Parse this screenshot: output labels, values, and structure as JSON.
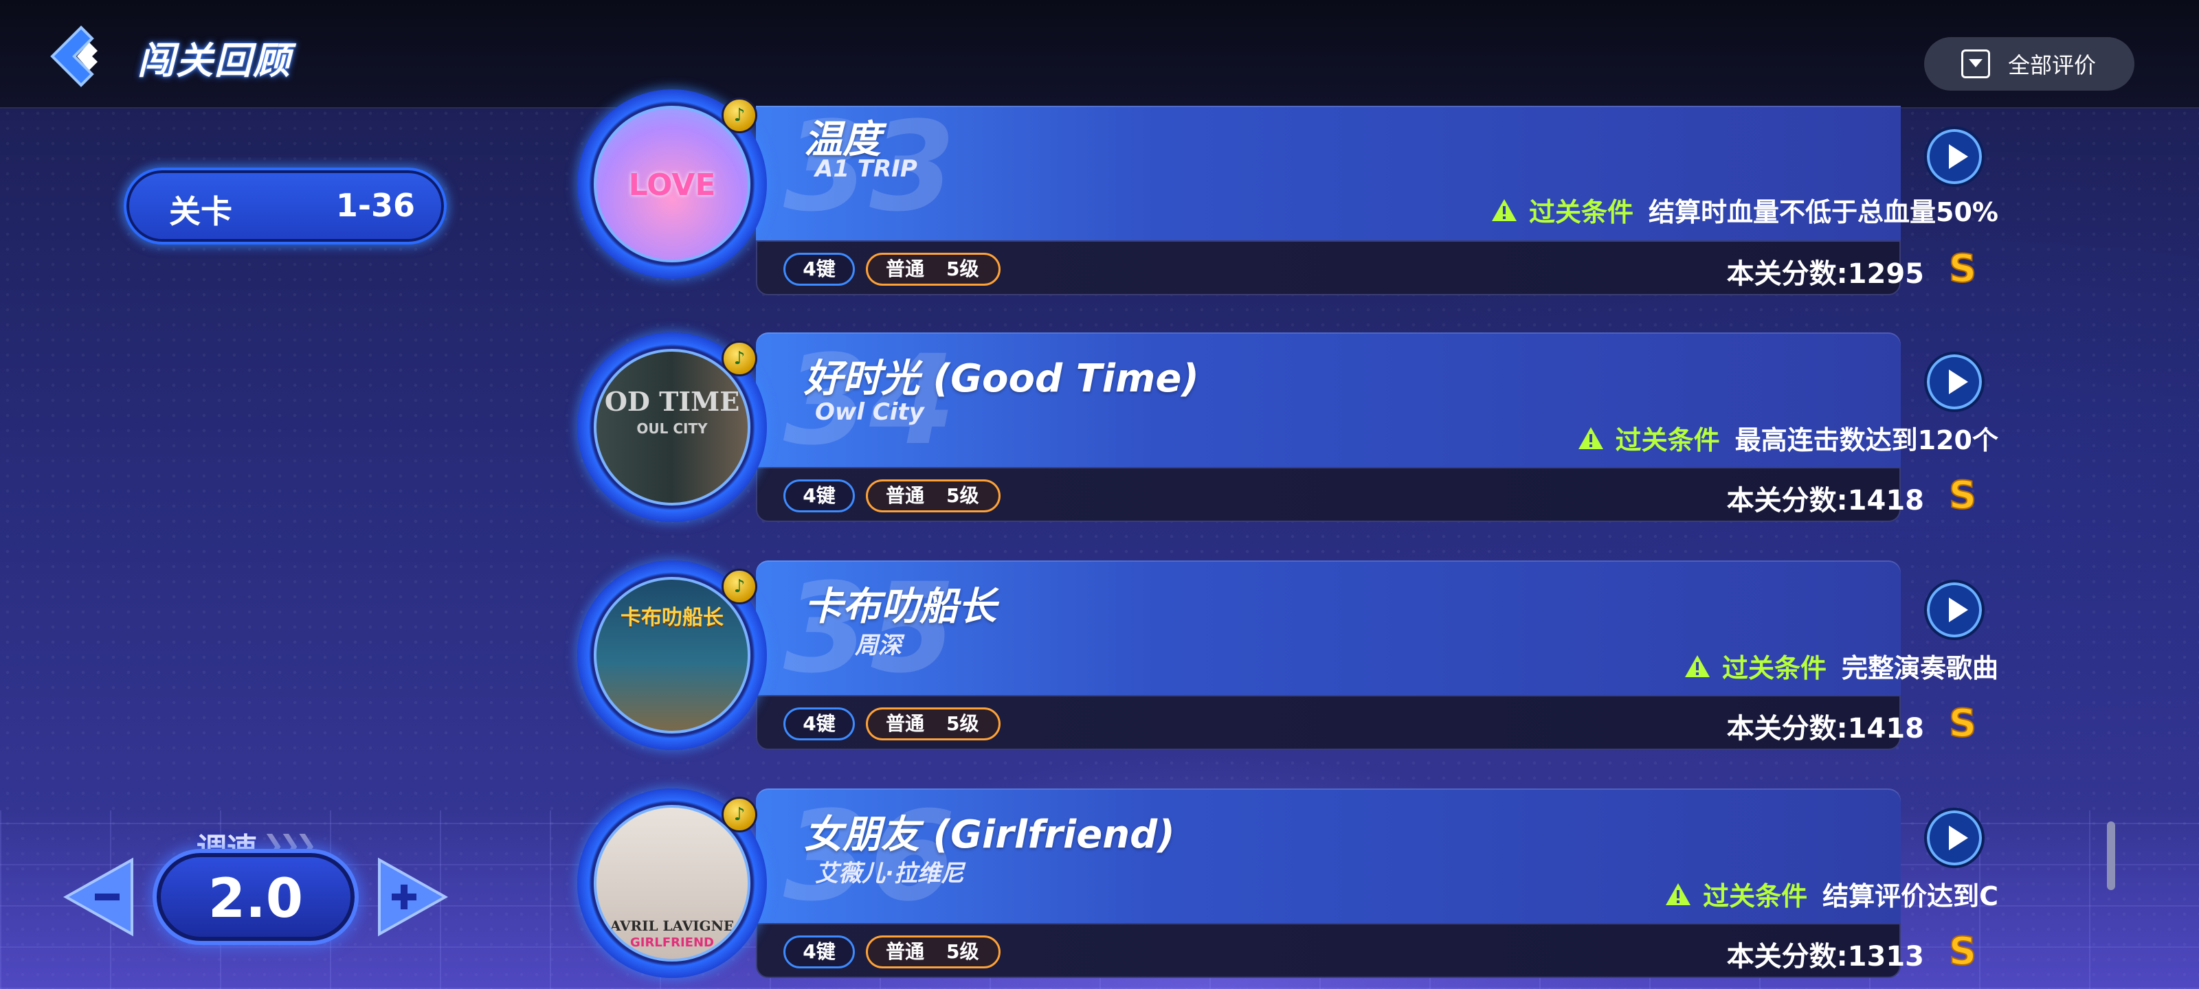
{
  "header": {
    "title": "闯关回顾",
    "filter_label": "全部评价",
    "back_icon": "back-arrow-icon",
    "filter_icon": "dropdown-icon"
  },
  "level": {
    "label": "关卡",
    "value": "1-36"
  },
  "speed": {
    "label": "调速",
    "value": "2.0",
    "minus": "−",
    "plus": "+"
  },
  "colors": {
    "condition_label": "#b6ff3a",
    "accent": "#3d8bff",
    "difficulty_border": "#ffa236",
    "grade": "#ffbe1a"
  },
  "songs": [
    {
      "number": "33",
      "title": "温度",
      "artist": "A1 TRIP",
      "art_text": "LOVE",
      "medal": "♪",
      "condition_label": "过关条件",
      "condition_text": "结算时血量不低于总血量50%",
      "keys": "4键",
      "difficulty": "普通",
      "difficulty_level": "5级",
      "score_label": "本关分数:",
      "score": "1295",
      "grade": "S"
    },
    {
      "number": "34",
      "title": "好时光 (Good Time)",
      "artist": "Owl City",
      "art_text": "OD TIME",
      "art_subtext": "OUL CITY",
      "medal": "♪",
      "condition_label": "过关条件",
      "condition_text": "最高连击数达到120个",
      "keys": "4键",
      "difficulty": "普通",
      "difficulty_level": "5级",
      "score_label": "本关分数:",
      "score": "1418",
      "grade": "S"
    },
    {
      "number": "35",
      "title": "卡布叻船长",
      "artist": "周深",
      "art_text": "卡布叻船长",
      "medal": "♪",
      "condition_label": "过关条件",
      "condition_text": "完整演奏歌曲",
      "keys": "4键",
      "difficulty": "普通",
      "difficulty_level": "5级",
      "score_label": "本关分数:",
      "score": "1418",
      "grade": "S"
    },
    {
      "number": "36",
      "title": "女朋友 (Girlfriend)",
      "artist": "艾薇儿·拉维尼",
      "art_text": "AVRIL LAVIGNE",
      "art_subtext": "GIRLFRIEND",
      "medal": "♪",
      "condition_label": "过关条件",
      "condition_text": "结算评价达到C",
      "keys": "4键",
      "difficulty": "普通",
      "difficulty_level": "5级",
      "score_label": "本关分数:",
      "score": "1313",
      "grade": "S"
    }
  ]
}
